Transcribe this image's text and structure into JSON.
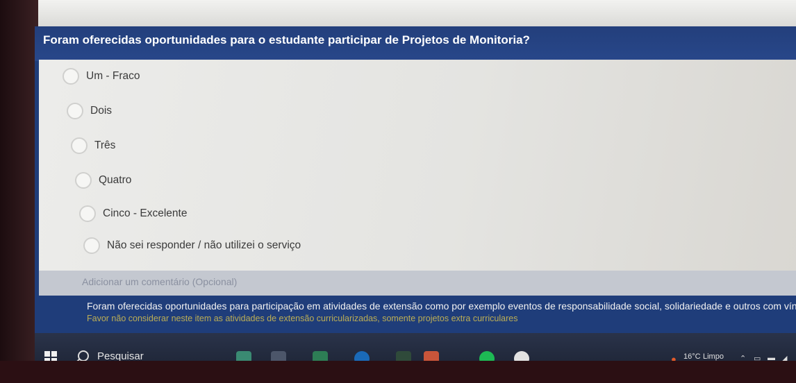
{
  "question": {
    "title": "Foram oferecidas oportunidades para o estudante participar de Projetos de Monitoria?"
  },
  "options": [
    {
      "label": "Um - Fraco"
    },
    {
      "label": "Dois"
    },
    {
      "label": "Três"
    },
    {
      "label": "Quatro"
    },
    {
      "label": "Cinco - Excelente"
    },
    {
      "label": "Não sei responder / não utilizei o serviço"
    }
  ],
  "comment": {
    "placeholder": "Adicionar um comentário (Opcional)"
  },
  "next_question": {
    "text": "Foram oferecidas oportunidades para participação em atividades de extensão como por exemplo eventos de responsabilidade social, solidariedade e outros com vínculo com a soc",
    "note": "Favor não considerar neste item as atividades de extensão curricularizadas, somente projetos extra curriculares"
  },
  "taskbar": {
    "search_label": "Pesquisar",
    "weather_temp": "16°C",
    "weather_text": "Limpo"
  },
  "icons": {
    "start": "windows-start-icon",
    "search": "search-icon",
    "weather": "weather-icon"
  }
}
